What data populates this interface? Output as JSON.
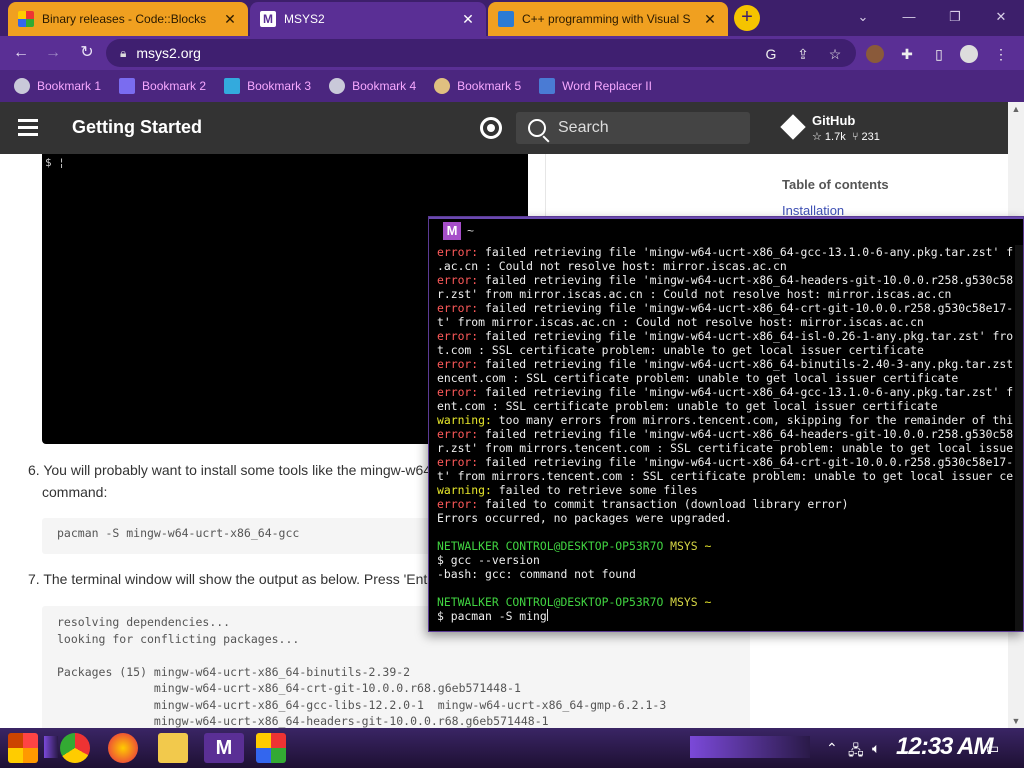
{
  "browser": {
    "tabs": [
      {
        "title": "Binary releases - Code::Blocks",
        "active": false
      },
      {
        "title": "MSYS2",
        "active": true
      },
      {
        "title": "C++ programming with Visual S",
        "active": false
      }
    ],
    "new_tab_glyph": "+",
    "url": "msys2.org",
    "bookmarks": [
      {
        "label": "Bookmark 1",
        "icon": "globe-icon"
      },
      {
        "label": "Bookmark 2",
        "icon": "bookmark-icon"
      },
      {
        "label": "Bookmark 3",
        "icon": "bookmark-icon"
      },
      {
        "label": "Bookmark 4",
        "icon": "globe-icon"
      },
      {
        "label": "Bookmark 5",
        "icon": "bookmark-icon"
      },
      {
        "label": "Word Replacer II",
        "icon": "extension-icon"
      }
    ],
    "window_controls": [
      "⌄",
      "—",
      "❐",
      "✕"
    ]
  },
  "docs": {
    "title": "Getting Started",
    "search_placeholder": "Search",
    "github": {
      "name": "GitHub",
      "stars": "☆ 1.7k",
      "forks": "⑂ 231"
    },
    "toc_title": "Table of contents",
    "toc_link": "Installation",
    "snippet_prompt": "$ ¦",
    "step6_num": "6.",
    "step6_text": "You will probably want to install some tools like the mingw-w64",
    "step6_text2": "command:",
    "step6_code": "pacman -S mingw-w64-ucrt-x86_64-gcc",
    "step7_num": "7.",
    "step7_text": "The terminal window will show the output as below. Press 'Ent",
    "step7_code": "resolving dependencies...\nlooking for conflicting packages...\n\nPackages (15) mingw-w64-ucrt-x86_64-binutils-2.39-2\n              mingw-w64-ucrt-x86_64-crt-git-10.0.0.r68.g6eb571448-1\n              mingw-w64-ucrt-x86_64-gcc-libs-12.2.0-1  mingw-w64-ucrt-x86_64-gmp-6.2.1-3\n              mingw-w64-ucrt-x86_64-headers-git-10.0.0.r68.g6eb571448-1"
  },
  "terminal": {
    "title": "~",
    "lines": [
      {
        "tag": "error:",
        "text": " failed retrieving file 'mingw-w64-ucrt-x86_64-gcc-13.1.0-6-any.pkg.tar.zst' f"
      },
      {
        "tag": "",
        "text": ".ac.cn : Could not resolve host: mirror.iscas.ac.cn"
      },
      {
        "tag": "error:",
        "text": " failed retrieving file 'mingw-w64-ucrt-x86_64-headers-git-10.0.0.r258.g530c58"
      },
      {
        "tag": "",
        "text": "r.zst' from mirror.iscas.ac.cn : Could not resolve host: mirror.iscas.ac.cn"
      },
      {
        "tag": "error:",
        "text": " failed retrieving file 'mingw-w64-ucrt-x86_64-crt-git-10.0.0.r258.g530c58e17-"
      },
      {
        "tag": "",
        "text": "t' from mirror.iscas.ac.cn : Could not resolve host: mirror.iscas.ac.cn"
      },
      {
        "tag": "error:",
        "text": " failed retrieving file 'mingw-w64-ucrt-x86_64-isl-0.26-1-any.pkg.tar.zst' fro"
      },
      {
        "tag": "",
        "text": "t.com : SSL certificate problem: unable to get local issuer certificate"
      },
      {
        "tag": "error:",
        "text": " failed retrieving file 'mingw-w64-ucrt-x86_64-binutils-2.40-3-any.pkg.tar.zst"
      },
      {
        "tag": "",
        "text": "encent.com : SSL certificate problem: unable to get local issuer certificate"
      },
      {
        "tag": "error:",
        "text": " failed retrieving file 'mingw-w64-ucrt-x86_64-gcc-13.1.0-6-any.pkg.tar.zst' f"
      },
      {
        "tag": "",
        "text": "ent.com : SSL certificate problem: unable to get local issuer certificate"
      },
      {
        "tag": "warning:",
        "text": " too many errors from mirrors.tencent.com, skipping for the remainder of thi"
      },
      {
        "tag": "error:",
        "text": " failed retrieving file 'mingw-w64-ucrt-x86_64-headers-git-10.0.0.r258.g530c58"
      },
      {
        "tag": "",
        "text": "r.zst' from mirrors.tencent.com : SSL certificate problem: unable to get local issue"
      },
      {
        "tag": "error:",
        "text": " failed retrieving file 'mingw-w64-ucrt-x86_64-crt-git-10.0.0.r258.g530c58e17-"
      },
      {
        "tag": "",
        "text": "t' from mirrors.tencent.com : SSL certificate problem: unable to get local issuer ce"
      },
      {
        "tag": "warning:",
        "text": " failed to retrieve some files"
      },
      {
        "tag": "error:",
        "text": " failed to commit transaction (download library error)"
      },
      {
        "tag": "",
        "text": "Errors occurred, no packages were upgraded."
      }
    ],
    "prompt1": {
      "user": "NETWALKER CONTROL@DESKTOP-OP53R7O",
      "sys": "MSYS",
      "path": "~"
    },
    "cmd1": "$ gcc --version",
    "out1": "-bash: gcc: command not found",
    "prompt2": {
      "user": "NETWALKER CONTROL@DESKTOP-OP53R7O",
      "sys": "MSYS",
      "path": "~"
    },
    "cmd2": "$ pacman -S ming"
  },
  "taskbar": {
    "clock": "12:33 AM",
    "items": [
      "start-icon",
      "chrome-icon",
      "firefox-icon",
      "folder-icon",
      "msys2-icon",
      "codeblocks-icon"
    ]
  },
  "colors": {
    "tabstrip": "#3d1f6b",
    "toolbar": "#5a2f95",
    "docs_header": "#333333",
    "error": "#ff5a5a",
    "warning": "#e8e82b",
    "prompt_user": "#41d341"
  }
}
